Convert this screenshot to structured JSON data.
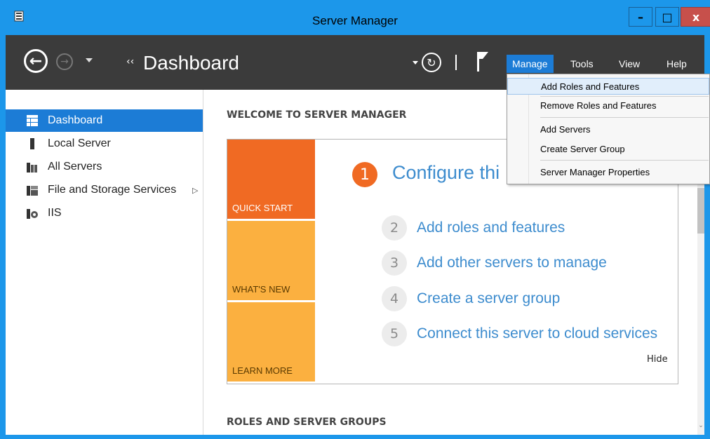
{
  "window": {
    "title": "Server Manager",
    "minimize_glyph": "–",
    "maximize_glyph": "□",
    "close_glyph": "x"
  },
  "nav": {
    "back_glyph": "←",
    "forward_glyph": "→",
    "breadcrumb_arrows": "‹‹",
    "breadcrumb": "Dashboard",
    "refresh_glyph": "↻",
    "menus": [
      "Manage",
      "Tools",
      "View",
      "Help"
    ]
  },
  "sidebar": {
    "items": [
      {
        "label": "Dashboard",
        "icon": "dashboard-icon"
      },
      {
        "label": "Local Server",
        "icon": "local-server-icon"
      },
      {
        "label": "All Servers",
        "icon": "all-servers-icon"
      },
      {
        "label": "File and Storage Services",
        "icon": "file-storage-icon"
      },
      {
        "label": "IIS",
        "icon": "iis-icon"
      }
    ],
    "chevron": "▷"
  },
  "main": {
    "welcome_heading": "WELCOME TO SERVER MANAGER",
    "roles_heading": "ROLES AND SERVER GROUPS",
    "tiles": [
      "QUICK START",
      "WHAT'S NEW",
      "LEARN MORE"
    ],
    "step1": {
      "number": "1",
      "text": "Configure thi"
    },
    "steps": [
      {
        "number": "2",
        "text": "Add roles and features"
      },
      {
        "number": "3",
        "text": "Add other servers to manage"
      },
      {
        "number": "4",
        "text": "Create a server group"
      },
      {
        "number": "5",
        "text": "Connect this server to cloud services"
      }
    ],
    "hide_label": "Hide"
  },
  "scrollbar": {
    "down_glyph": "⌄"
  },
  "manage_menu": {
    "items": [
      "Add Roles and Features",
      "Remove Roles and Features",
      "Add Servers",
      "Create Server Group",
      "Server Manager Properties"
    ]
  },
  "colors": {
    "accent": "#1c7cd6",
    "titlebar": "#1c97ea",
    "navbar": "#3b3b3b",
    "quick_start": "#f06a23",
    "tile_yellow": "#fbb040",
    "link": "#3d8cce"
  }
}
